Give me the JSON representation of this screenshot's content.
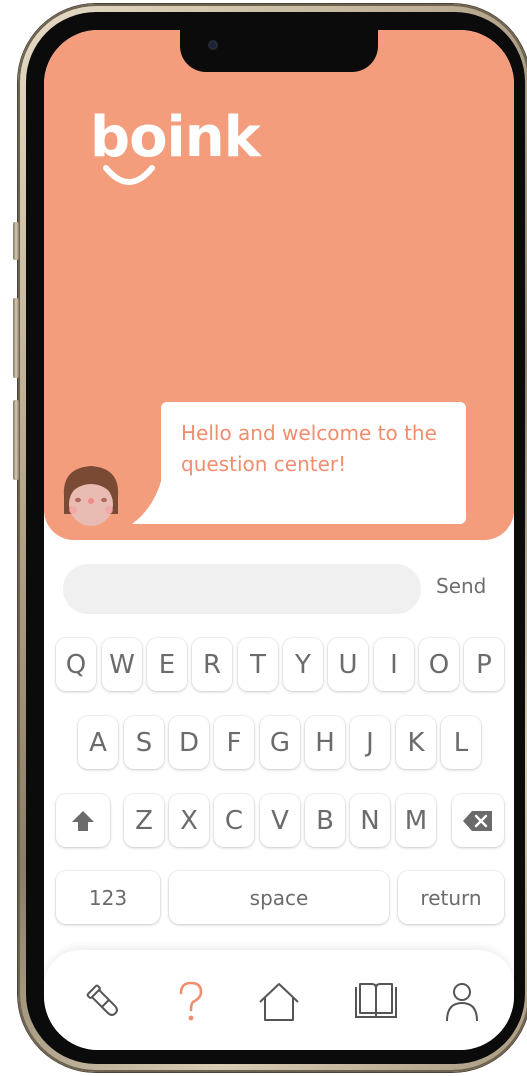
{
  "app": {
    "logo_text": "boink",
    "brand_color": "#f49d7c",
    "accent_text_color": "#f28d6e"
  },
  "chat": {
    "greeting": "Hello and welcome to the question center!",
    "avatar_icon": "girl-avatar-icon"
  },
  "composer": {
    "input_value": "",
    "send_label": "Send"
  },
  "keyboard": {
    "row1": [
      "Q",
      "W",
      "E",
      "R",
      "T",
      "Y",
      "U",
      "I",
      "O",
      "P"
    ],
    "row2": [
      "A",
      "S",
      "D",
      "F",
      "G",
      "H",
      "J",
      "K",
      "L"
    ],
    "row3": [
      "Z",
      "X",
      "C",
      "V",
      "B",
      "N",
      "M"
    ],
    "shift_icon": "shift-icon",
    "backspace_icon": "backspace-icon",
    "numbers_label": "123",
    "space_label": "space",
    "return_label": "return"
  },
  "tabbar": {
    "items": [
      {
        "icon": "test-tube-icon",
        "active": false
      },
      {
        "icon": "question-icon",
        "active": true
      },
      {
        "icon": "home-icon",
        "active": false
      },
      {
        "icon": "book-icon",
        "active": false
      },
      {
        "icon": "profile-icon",
        "active": false
      }
    ],
    "active_color": "#f28d6e",
    "inactive_color": "#555555"
  }
}
